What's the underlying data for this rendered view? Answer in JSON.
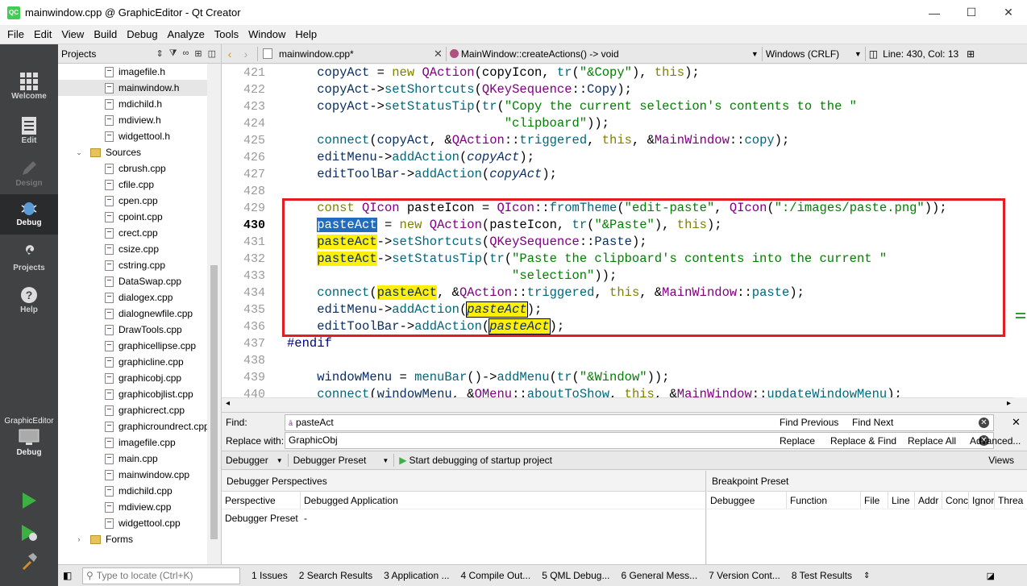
{
  "window": {
    "title": "mainwindow.cpp @ GraphicEditor - Qt Creator",
    "logo": "QC",
    "minimize": "—",
    "maximize": "☐",
    "close": "✕"
  },
  "menu": [
    "File",
    "Edit",
    "View",
    "Build",
    "Debug",
    "Analyze",
    "Tools",
    "Window",
    "Help"
  ],
  "modes": {
    "welcome": "Welcome",
    "edit": "Edit",
    "design": "Design",
    "debug": "Debug",
    "projects": "Projects",
    "help": "Help",
    "kit_project": "GraphicEditor",
    "kit_mode": "Debug"
  },
  "projects": {
    "title": "Projects",
    "headers_files": [
      "imagefile.h",
      "mainwindow.h",
      "mdichild.h",
      "mdiview.h",
      "widgettool.h"
    ],
    "sources_label": "Sources",
    "sources_files": [
      "cbrush.cpp",
      "cfile.cpp",
      "cpen.cpp",
      "cpoint.cpp",
      "crect.cpp",
      "csize.cpp",
      "cstring.cpp",
      "DataSwap.cpp",
      "dialogex.cpp",
      "dialognewfile.cpp",
      "DrawTools.cpp",
      "graphicellipse.cpp",
      "graphicline.cpp",
      "graphicobj.cpp",
      "graphicobjlist.cpp",
      "graphicrect.cpp",
      "graphicroundrect.cpp",
      "imagefile.cpp",
      "main.cpp",
      "mainwindow.cpp",
      "mdichild.cpp",
      "mdiview.cpp",
      "widgettool.cpp"
    ],
    "forms_label": "Forms"
  },
  "editor_bar": {
    "file": "mainwindow.cpp*",
    "symbol": "MainWindow::createActions() -> void",
    "encoding": "Windows (CRLF)",
    "position": "Line: 430, Col: 13"
  },
  "code_lines": [
    "421",
    "422",
    "423",
    "424",
    "425",
    "426",
    "427",
    "428",
    "429",
    "430",
    "431",
    "432",
    "433",
    "434",
    "435",
    "436",
    "437",
    "438",
    "439",
    "440"
  ],
  "find": {
    "find_label": "Find:",
    "find_value": "pasteAct",
    "replace_label": "Replace with:",
    "replace_value": "GraphicObj",
    "find_prev": "Find Previous",
    "find_next": "Find Next",
    "replace": "Replace",
    "replace_find": "Replace & Find",
    "replace_all": "Replace All",
    "advanced": "Advanced..."
  },
  "debugger_bar": {
    "debugger": "Debugger",
    "preset": "Debugger Preset",
    "start": "Start debugging of startup project",
    "views": "Views"
  },
  "perspectives": {
    "title": "Debugger Perspectives",
    "col1": "Perspective",
    "col2": "Debugged Application",
    "row_name": "Debugger Preset",
    "row_value": "-"
  },
  "breakpoints": {
    "title": "Breakpoint Preset",
    "cols": [
      "Debuggee",
      "Function",
      "File",
      "Line",
      "Addr",
      "Conc",
      "Ignor",
      "Threa"
    ]
  },
  "status": {
    "locate_placeholder": "Type to locate (Ctrl+K)",
    "tabs": [
      "1  Issues",
      "2  Search Results",
      "3  Application ...",
      "4  Compile Out...",
      "5  QML Debug...",
      "6  General Mess...",
      "7  Version Cont...",
      "8  Test Results"
    ]
  }
}
